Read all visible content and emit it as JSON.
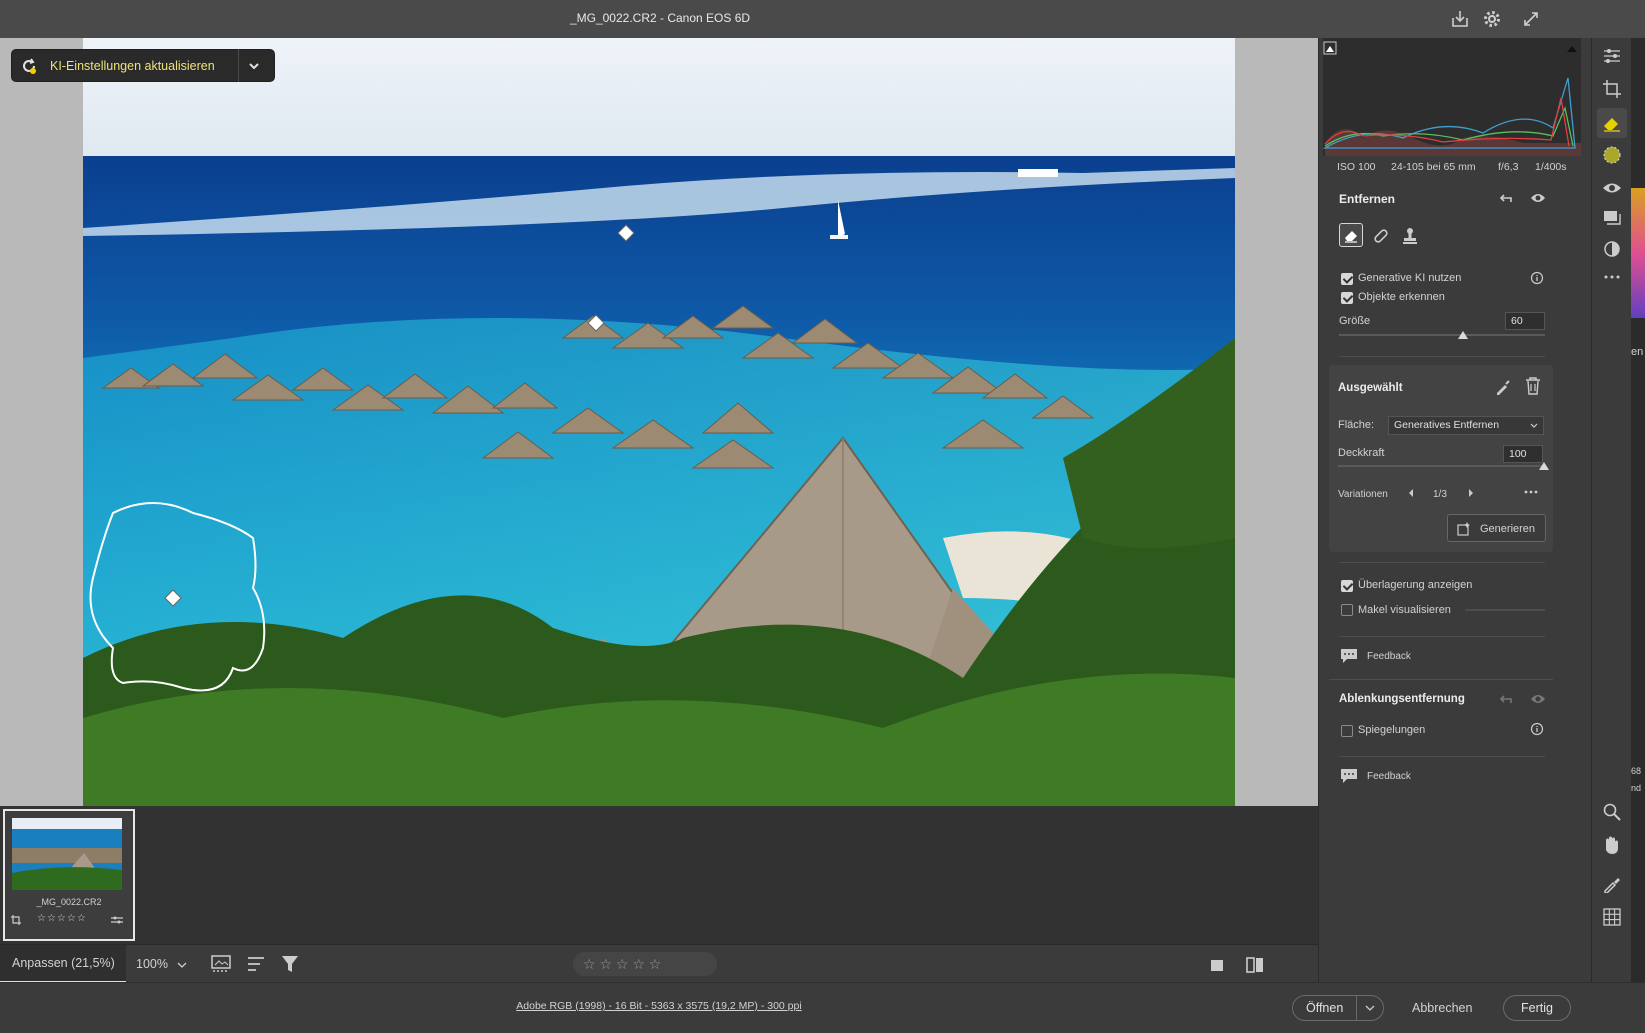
{
  "window": {
    "title": "_MG_0022.CR2 - Canon EOS 6D"
  },
  "titlebar_icons": [
    "save-icon",
    "gear-icon",
    "fullscreen-icon"
  ],
  "ai_update": {
    "label": "KI-Einstellungen aktualisieren"
  },
  "histogram": {
    "iso": "ISO 100",
    "lens": "24-105 bei 65 mm",
    "aperture": "f/6,3",
    "shutter": "1/400s"
  },
  "remove": {
    "heading": "Entfernen",
    "generative_ai": "Generative KI nutzen",
    "detect_objects": "Objekte erkennen",
    "size_label": "Größe",
    "size_value": "60",
    "size_fraction": 0.6
  },
  "selected": {
    "heading": "Ausgewählt",
    "area_label": "Fläche:",
    "area_value": "Generatives Entfernen",
    "opacity_label": "Deckkraft",
    "opacity_value": "100",
    "variations_label": "Variationen",
    "variations_value": "1/3",
    "generate_label": "Generieren"
  },
  "overlay": {
    "show_overlay": "Überlagerung anzeigen",
    "visualize_spots": "Makel visualisieren"
  },
  "feedback_label": "Feedback",
  "distraction": {
    "heading": "Ablenkungsentfernung",
    "reflections": "Spiegelungen"
  },
  "filmstrip": {
    "filename": "_MG_0022.CR2",
    "stars": "☆☆☆☆☆"
  },
  "bottombar": {
    "fit_label": "Anpassen (21,5%)",
    "zoom_value": "100%",
    "rating_stars": "☆ ☆ ☆ ☆ ☆"
  },
  "footer": {
    "info_link": "Adobe RGB (1998) - 16 Bit - 5363 x 3575 (19,2 MP) - 300 ppi",
    "open_label": "Öffnen",
    "cancel_label": "Abbrechen",
    "done_label": "Fertig"
  },
  "edge_text": {
    "a": "en",
    "b": "68",
    "c": "nd"
  }
}
